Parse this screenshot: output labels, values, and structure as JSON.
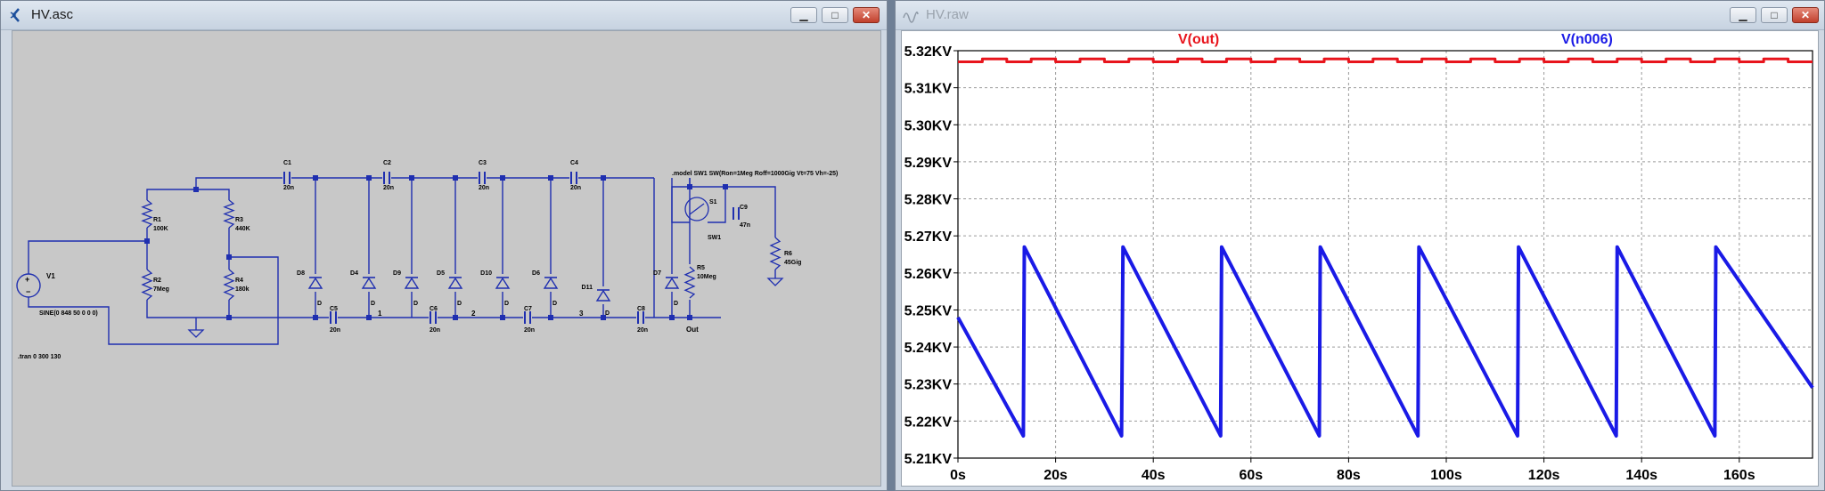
{
  "schematic_window": {
    "title": "HV.asc",
    "controls": {
      "minimize": "▁",
      "maximize": "□",
      "close": "✕"
    },
    "components": {
      "V1": "V1",
      "V1_value": "SINE(0 848 50 0 0 0)",
      "R1": "R1",
      "R1_value": "100K",
      "R2": "R2",
      "R2_value": "7Meg",
      "R3": "R3",
      "R3_value": "440K",
      "R4": "R4",
      "R4_value": "180k",
      "R5": "R5",
      "R5_value": "10Meg",
      "R6": "R6",
      "R6_value": "45Gig",
      "C1": "C1",
      "C1_value": "20n",
      "C2": "C2",
      "C2_value": "20n",
      "C3": "C3",
      "C3_value": "20n",
      "C4": "C4",
      "C4_value": "20n",
      "C5": "C5",
      "C5_value": "20n",
      "C6": "C6",
      "C6_value": "20n",
      "C7": "C7",
      "C7_value": "20n",
      "C8": "C8",
      "C8_value": "20n",
      "C9": "C9",
      "C9_value": "47n",
      "D8": "D8",
      "D4": "D4",
      "D9": "D9",
      "D5": "D5",
      "D10": "D10",
      "D6": "D6",
      "D11": "D11",
      "D7": "D7",
      "D_model": "D",
      "S1": "S1",
      "S1_model": "SW1",
      "node1": "1",
      "node2": "2",
      "node3": "3",
      "out": "Out"
    },
    "directives": {
      "tran": ".tran 0 300 130",
      "model": ".model SW1 SW(Ron=1Meg Roff=1000Gig Vt=75 Vh=-25)"
    }
  },
  "waveform_window": {
    "title": "HV.raw",
    "controls": {
      "minimize": "▁",
      "maximize": "□",
      "close": "✕"
    },
    "trace_labels": {
      "out": "V(out)",
      "n006": "V(n006)"
    },
    "colors": {
      "out": "#e8141c",
      "n006": "#1a1ae6",
      "grid": "#9a9a9a"
    }
  },
  "chart_data": {
    "type": "line",
    "title": "",
    "xlabel": "",
    "ylabel": "",
    "xlim": [
      0,
      175
    ],
    "ylim": [
      5.21,
      5.32
    ],
    "x_ticks": [
      0,
      20,
      40,
      60,
      80,
      100,
      120,
      140,
      160
    ],
    "x_tick_labels": [
      "0s",
      "20s",
      "40s",
      "60s",
      "80s",
      "100s",
      "120s",
      "140s",
      "160s"
    ],
    "y_ticks": [
      5.21,
      5.22,
      5.23,
      5.24,
      5.25,
      5.26,
      5.27,
      5.28,
      5.29,
      5.3,
      5.31,
      5.32
    ],
    "y_tick_labels": [
      "5.21KV",
      "5.22KV",
      "5.23KV",
      "5.24KV",
      "5.25KV",
      "5.26KV",
      "5.27KV",
      "5.28KV",
      "5.29KV",
      "5.30KV",
      "5.31KV",
      "5.32KV"
    ],
    "grid": true,
    "series": [
      {
        "name": "V(out)",
        "x": [
          0,
          5,
          5,
          10,
          10,
          15,
          15,
          20,
          20,
          25,
          25,
          30,
          30,
          35,
          35,
          40,
          40,
          45,
          45,
          50,
          50,
          55,
          55,
          60,
          60,
          65,
          65,
          70,
          70,
          75,
          75,
          80,
          80,
          85,
          85,
          90,
          90,
          95,
          95,
          100,
          100,
          105,
          105,
          110,
          110,
          115,
          115,
          120,
          120,
          125,
          125,
          130,
          130,
          135,
          135,
          140,
          140,
          145,
          145,
          150,
          150,
          155,
          155,
          160,
          160,
          165,
          165,
          170,
          170,
          175
        ],
        "y": [
          5.317,
          5.317,
          5.3178,
          5.3178,
          5.317,
          5.317,
          5.3178,
          5.3178,
          5.317,
          5.317,
          5.3178,
          5.3178,
          5.317,
          5.317,
          5.3178,
          5.3178,
          5.317,
          5.317,
          5.3178,
          5.3178,
          5.317,
          5.317,
          5.3178,
          5.3178,
          5.317,
          5.317,
          5.3178,
          5.3178,
          5.317,
          5.317,
          5.3178,
          5.3178,
          5.317,
          5.317,
          5.3178,
          5.3178,
          5.317,
          5.317,
          5.3178,
          5.3178,
          5.317,
          5.317,
          5.3178,
          5.3178,
          5.317,
          5.317,
          5.3178,
          5.3178,
          5.317,
          5.317,
          5.3178,
          5.3178,
          5.317,
          5.317,
          5.3178,
          5.3178,
          5.317,
          5.317,
          5.3178,
          5.3178,
          5.317,
          5.317,
          5.3178,
          5.3178,
          5.317,
          5.317,
          5.3178,
          5.3178,
          5.317,
          5.317
        ]
      },
      {
        "name": "V(n006)",
        "x": [
          0,
          13.4,
          13.6,
          33.5,
          33.8,
          53.8,
          54.0,
          74.0,
          74.2,
          94.2,
          94.4,
          114.6,
          114.8,
          134.8,
          135.0,
          155.0,
          155.2,
          175
        ],
        "y": [
          5.248,
          5.216,
          5.267,
          5.216,
          5.267,
          5.216,
          5.267,
          5.216,
          5.267,
          5.216,
          5.267,
          5.216,
          5.267,
          5.216,
          5.267,
          5.216,
          5.267,
          5.229
        ]
      }
    ]
  }
}
